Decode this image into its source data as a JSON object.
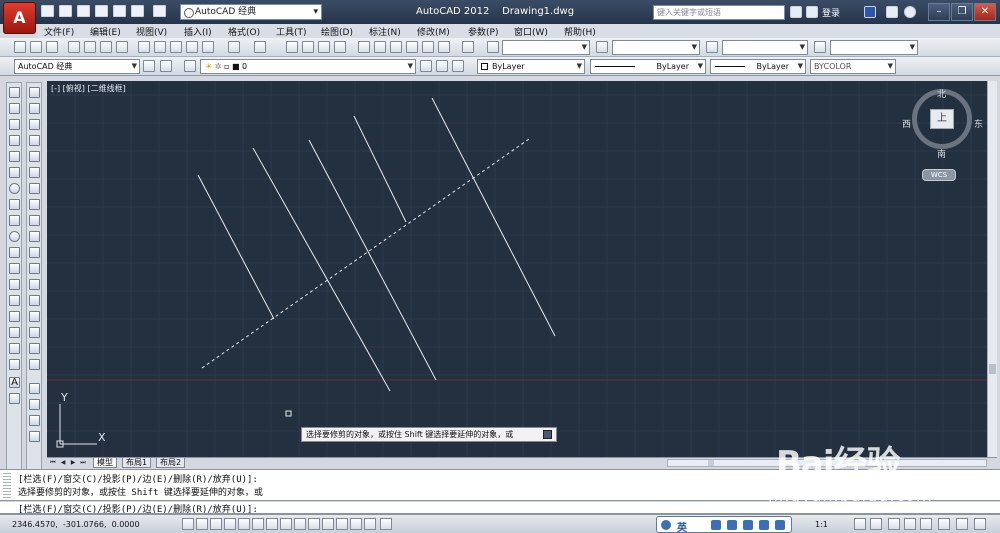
{
  "titlebar": {
    "app_button": "A",
    "workspace": "AutoCAD 经典",
    "title": "AutoCAD 2012    Drawing1.dwg",
    "search_placeholder": "键入关键字或短语",
    "login": "登录"
  },
  "menu": [
    "文件(F)",
    "编辑(E)",
    "视图(V)",
    "插入(I)",
    "格式(O)",
    "工具(T)",
    "绘图(D)",
    "标注(N)",
    "修改(M)",
    "参数(P)",
    "窗口(W)",
    "帮助(H)"
  ],
  "toolbar": {
    "workspace_combo": "AutoCAD 经典",
    "layer_combo": "0",
    "color_combo": "ByLayer",
    "linetype_combo": "ByLayer",
    "lineweight_combo": "ByLayer",
    "plotstyle_combo": "BYCOLOR"
  },
  "viewport": {
    "label": "[-] [俯视] [二维线框]",
    "viewcube": {
      "top": "上",
      "north": "北",
      "south": "南",
      "west": "西",
      "east": "东"
    },
    "wcs": "WCS",
    "ucs_x": "X",
    "ucs_y": "Y",
    "tooltip": "选择要修剪的对象，或按住 Shift 键选择要延伸的对象，或"
  },
  "tabs": [
    "模型",
    "布局1",
    "布局2"
  ],
  "command": {
    "history": [
      "[栏选(F)/窗交(C)/投影(P)/边(E)/删除(R)/放弃(U)]:",
      "选择要修剪的对象，或按住 Shift 键选择要延伸的对象，或"
    ],
    "prompt": "[栏选(F)/窗交(C)/投影(P)/边(E)/删除(R)/放弃(U)]:"
  },
  "status": {
    "coords": "2346.4570,  -301.0766,  0.0000",
    "ime_language": "英",
    "scale": "1:1"
  },
  "watermark": {
    "brand": "Bai经验",
    "url": "jingyan.baidu.com"
  },
  "colors": {
    "canvas": "#233040",
    "title_bar": "#2f4058",
    "app_button": "#c8291c"
  }
}
